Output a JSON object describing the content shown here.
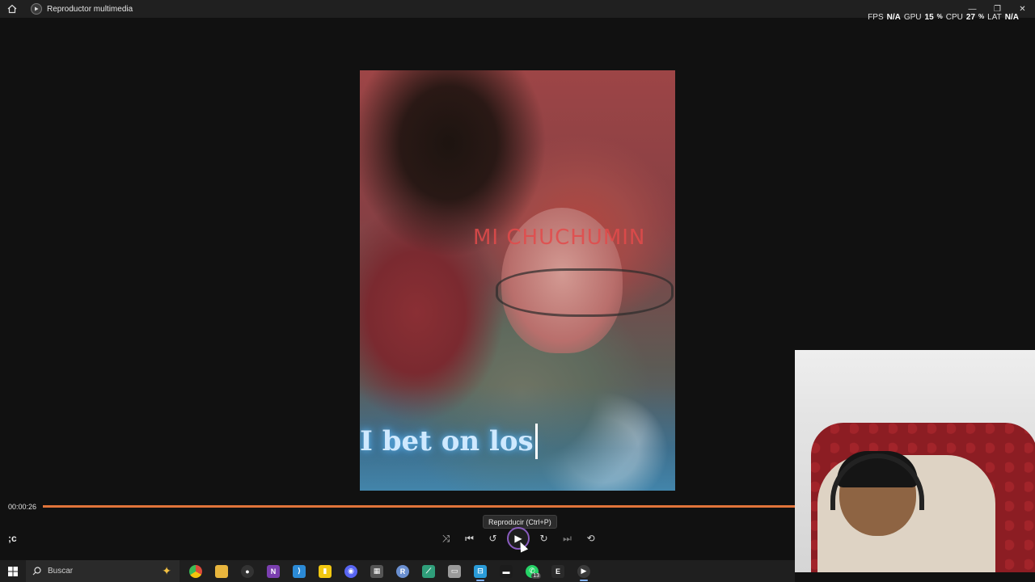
{
  "window": {
    "title": "Reproductor multimedia",
    "controls": {
      "minimize": "—",
      "restore": "❐",
      "close": "✕"
    }
  },
  "perf_overlay": {
    "fps_label": "FPS",
    "fps_value": "N/A",
    "gpu_label": "GPU",
    "gpu_value": "15",
    "gpu_unit": "%",
    "cpu_label": "CPU",
    "cpu_value": "27",
    "cpu_unit": "%",
    "lat_label": "LAT",
    "lat_value": "N/A"
  },
  "video": {
    "overlay_red_text": "MI CHUCHUMIN",
    "lyric_text": "I bet on los"
  },
  "player": {
    "timecode": "00:00:26",
    "progress_fraction": 1.0,
    "progress_color": "#e0743a",
    "tooltip": "Reproducir (Ctrl+P)",
    "media_label": ";c",
    "accent_color": "#8a5cc0",
    "controls": [
      {
        "name": "shuffle-button",
        "icon": "shuffle-icon",
        "glyph": "⤨"
      },
      {
        "name": "previous-button",
        "icon": "previous-icon",
        "glyph": "⏮"
      },
      {
        "name": "rewind-10-button",
        "icon": "rewind-10-icon",
        "glyph": "↺"
      },
      {
        "name": "play-button",
        "icon": "play-icon",
        "glyph": "▶"
      },
      {
        "name": "forward-30-button",
        "icon": "forward-30-icon",
        "glyph": "↻"
      },
      {
        "name": "next-button",
        "icon": "next-icon",
        "glyph": "⏭"
      },
      {
        "name": "repeat-off-button",
        "icon": "repeat-off-icon",
        "glyph": "⟲"
      }
    ]
  },
  "taskbar": {
    "search_placeholder": "Buscar",
    "apps": [
      {
        "name": "chrome",
        "icon": "chrome-icon",
        "color": "#dd4b39",
        "letter": ""
      },
      {
        "name": "file-explorer",
        "icon": "folder-icon",
        "color": "#e8b53d",
        "letter": ""
      },
      {
        "name": "obs",
        "icon": "obs-icon",
        "color": "#333333",
        "letter": "●"
      },
      {
        "name": "onenote",
        "icon": "onenote-icon",
        "color": "#7b3fb0",
        "letter": "N"
      },
      {
        "name": "vscode",
        "icon": "vscode-icon",
        "color": "#2b8ad6",
        "letter": "⟩"
      },
      {
        "name": "power-bi",
        "icon": "powerbi-icon",
        "color": "#f2c811",
        "letter": "▮"
      },
      {
        "name": "discord",
        "icon": "discord-icon",
        "color": "#5865f2",
        "letter": "◉"
      },
      {
        "name": "calculator",
        "icon": "calculator-icon",
        "color": "#555555",
        "letter": "▦"
      },
      {
        "name": "r-studio",
        "icon": "r-icon",
        "color": "#6a8fd0",
        "letter": "R"
      },
      {
        "name": "maps",
        "icon": "maps-icon",
        "color": "#2f9e7a",
        "letter": "⟋"
      },
      {
        "name": "files",
        "icon": "files-icon",
        "color": "#9a9a9a",
        "letter": "▭"
      },
      {
        "name": "store",
        "icon": "store-icon",
        "color": "#2a9bd8",
        "letter": "⊟",
        "active": true
      },
      {
        "name": "terminal",
        "icon": "terminal-icon",
        "color": "#1c1c1c",
        "letter": "▬"
      },
      {
        "name": "whatsapp",
        "icon": "whatsapp-icon",
        "color": "#25d366",
        "letter": "✆",
        "badge": "13"
      },
      {
        "name": "epic-games",
        "icon": "epic-icon",
        "color": "#2a2a2a",
        "letter": "E"
      },
      {
        "name": "media-player",
        "icon": "media-player-icon",
        "color": "#3a3a3a",
        "letter": "▶",
        "active": true
      }
    ]
  }
}
